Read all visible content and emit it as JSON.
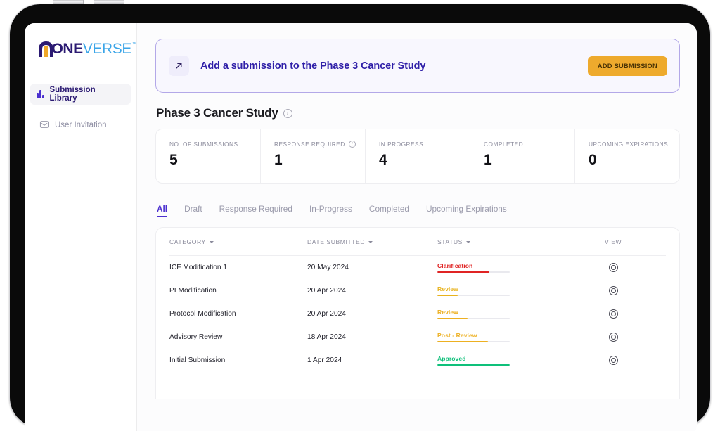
{
  "sidebar": {
    "logo": {
      "part1": "ONE",
      "part2": "VERSE",
      "tm": "™"
    },
    "items": [
      {
        "label": "Submission Library",
        "icon": "bar-chart-icon",
        "active": true
      },
      {
        "label": "User Invitation",
        "icon": "envelope-icon",
        "active": false
      }
    ]
  },
  "banner": {
    "icon": "arrow-up-right-icon",
    "title": "Add a submission to the Phase 3 Cancer Study",
    "button_label": "ADD SUBMISSION",
    "button_color": "#eeaa2d",
    "border_color": "#b3a8e8",
    "background_color": "#f8f7fe"
  },
  "page": {
    "title": "Phase 3 Cancer Study",
    "info_icon": "info-icon"
  },
  "stats": [
    {
      "label": "NO. OF SUBMISSIONS",
      "value": "5",
      "has_info": false
    },
    {
      "label": "RESPONSE REQUIRED",
      "value": "1",
      "has_info": true
    },
    {
      "label": "IN PROGRESS",
      "value": "4",
      "has_info": false
    },
    {
      "label": "COMPLETED",
      "value": "1",
      "has_info": false
    },
    {
      "label": "UPCOMING EXPIRATIONS",
      "value": "0",
      "has_info": false
    }
  ],
  "tabs": [
    {
      "label": "All",
      "active": true
    },
    {
      "label": "Draft",
      "active": false
    },
    {
      "label": "Response Required",
      "active": false
    },
    {
      "label": "In-Progress",
      "active": false
    },
    {
      "label": "Completed",
      "active": false
    },
    {
      "label": "Upcoming Expirations",
      "active": false
    }
  ],
  "table": {
    "columns": [
      {
        "label": "CATEGORY",
        "sortable": true
      },
      {
        "label": "DATE  SUBMITTED",
        "sortable": true
      },
      {
        "label": "STATUS",
        "sortable": true
      },
      {
        "label": "VIEW",
        "sortable": false
      }
    ],
    "rows": [
      {
        "category": "ICF Modification 1",
        "date": "20 May 2024",
        "status": "Clarification",
        "status_color": "#e02424",
        "progress": 72,
        "view_icon": "view-target-icon"
      },
      {
        "category": "PI Modification",
        "date": "20 Apr 2024",
        "status": "Review",
        "status_color": "#e8b31e",
        "progress": 28,
        "view_icon": "view-target-icon"
      },
      {
        "category": "Protocol Modification",
        "date": "20 Apr 2024",
        "status": "Review",
        "status_color": "#edb021",
        "progress": 42,
        "view_icon": "view-target-icon"
      },
      {
        "category": "Advisory Review",
        "date": "18 Apr 2024",
        "status": "Post - Review",
        "status_color": "#edb021",
        "progress": 70,
        "view_icon": "view-target-icon"
      },
      {
        "category": "Initial Submission",
        "date": "1 Apr 2024",
        "status": "Approved",
        "status_color": "#0ec07a",
        "progress": 100,
        "view_icon": "view-target-icon"
      }
    ]
  },
  "theme": {
    "accent": "#4b2fcf",
    "brand_dark": "#2b1a72",
    "brand_light": "#3aa5e8",
    "brand_orange": "#f0a82a"
  }
}
